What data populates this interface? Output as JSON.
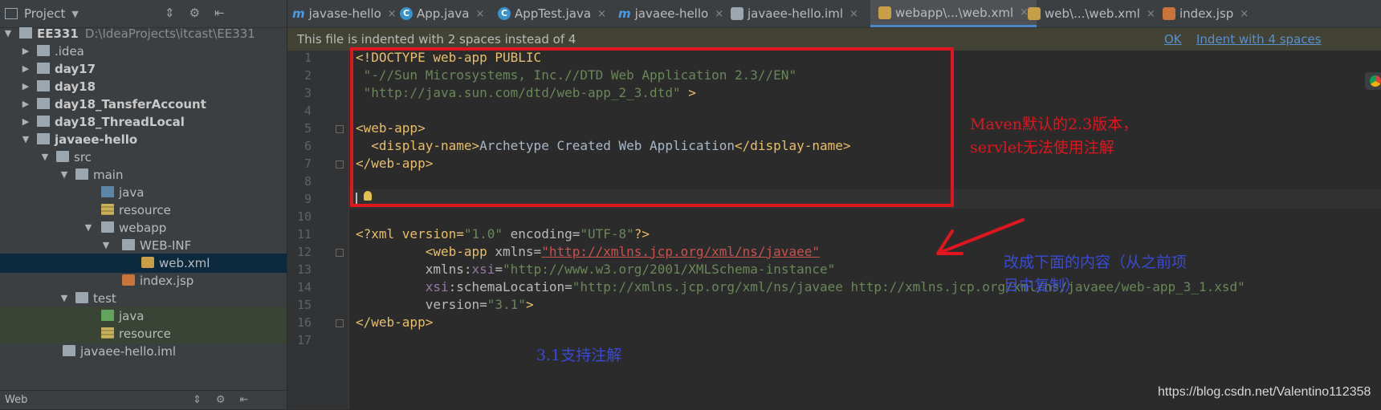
{
  "sidebar": {
    "title": "Project",
    "tree": [
      {
        "label": "EE331",
        "path": "D:\\IdeaProjects\\itcast\\EE331",
        "arrow": "▼"
      },
      {
        "label": ".idea",
        "arrow": "▶"
      },
      {
        "label": "day17",
        "arrow": "▶"
      },
      {
        "label": "day18",
        "arrow": "▶"
      },
      {
        "label": "day18_TansferAccount",
        "arrow": "▶"
      },
      {
        "label": "day18_ThreadLocal",
        "arrow": "▶"
      },
      {
        "label": "javaee-hello",
        "arrow": "▼"
      },
      {
        "label": "src",
        "arrow": "▼"
      },
      {
        "label": "main",
        "arrow": "▼"
      },
      {
        "label": "java"
      },
      {
        "label": "resource"
      },
      {
        "label": "webapp",
        "arrow": "▼"
      },
      {
        "label": "WEB-INF",
        "arrow": "▼"
      },
      {
        "label": "web.xml"
      },
      {
        "label": "index.jsp"
      },
      {
        "label": "test",
        "arrow": "▼"
      },
      {
        "label": "java"
      },
      {
        "label": "resource"
      },
      {
        "label": "javaee-hello.iml"
      }
    ],
    "bottom_label": "Web"
  },
  "tabs": [
    {
      "label": "javase-hello",
      "icon": "m"
    },
    {
      "label": "App.java",
      "icon": "C"
    },
    {
      "label": "AppTest.java",
      "icon": "C"
    },
    {
      "label": "javaee-hello",
      "icon": "m"
    },
    {
      "label": "javaee-hello.iml",
      "icon": "f"
    },
    {
      "label": "webapp\\...\\web.xml",
      "icon": "x"
    },
    {
      "label": "web\\...\\web.xml",
      "icon": "x"
    },
    {
      "label": "index.jsp",
      "icon": "j"
    }
  ],
  "notification": {
    "message": "This file is indented with 2 spaces instead of 4",
    "ok": "OK",
    "indent": "Indent with 4 spaces"
  },
  "line_numbers": [
    "1",
    "2",
    "3",
    "4",
    "5",
    "6",
    "7",
    "8",
    "9",
    "10",
    "11",
    "12",
    "13",
    "14",
    "15",
    "16",
    "17"
  ],
  "code": {
    "l1a": "<!DOCTYPE web-app PUBLIC",
    "l2": " \"-//Sun Microsystems, Inc.//DTD Web Application 2.3//EN\"",
    "l3a": " \"http://java.sun.com/dtd/web-app_2_3.dtd\"",
    "l3b": " >",
    "l5": "<web-app>",
    "l6a": "  <display-name>",
    "l6b": "Archetype Created Web Application",
    "l6c": "</display-name>",
    "l7": "</web-app>",
    "l11a": "<?xml version=",
    "l11b": "\"1.0\"",
    "l11c": " encoding=",
    "l11d": "\"UTF-8\"",
    "l11e": "?>",
    "l12a": "         <web-app ",
    "l12b": "xmlns=",
    "l12c": "\"http://xmlns.jcp.org/xml/ns/javaee\"",
    "l13a": "         xmlns:",
    "l13b": "xsi",
    "l13c": "=",
    "l13d": "\"http://www.w3.org/2001/XMLSchema-instance\"",
    "l14a": "         ",
    "l14b": "xsi",
    "l14c": ":schemaLocation=",
    "l14d": "\"http://xmlns.jcp.org/xml/ns/javaee http://xmlns.jcp.org/xml/ns/javaee/web-app_3_1.xsd\"",
    "l15a": "         version=",
    "l15b": "\"3.1\"",
    "l15c": ">",
    "l16": "</web-app>"
  },
  "annotations": {
    "red_note": "Maven默认的2.3版本，servlet无法使用注解",
    "blue_note": "改成下面的内容（从之前项目中复制）",
    "blue_note2": "3.1支持注解"
  },
  "watermark": "https://blog.csdn.net/Valentino112358",
  "colors": {
    "annotation_red": "#e0161e",
    "annotation_blue": "#3a4ad6",
    "tag": "#e8bf6a",
    "string": "#6a8759"
  }
}
